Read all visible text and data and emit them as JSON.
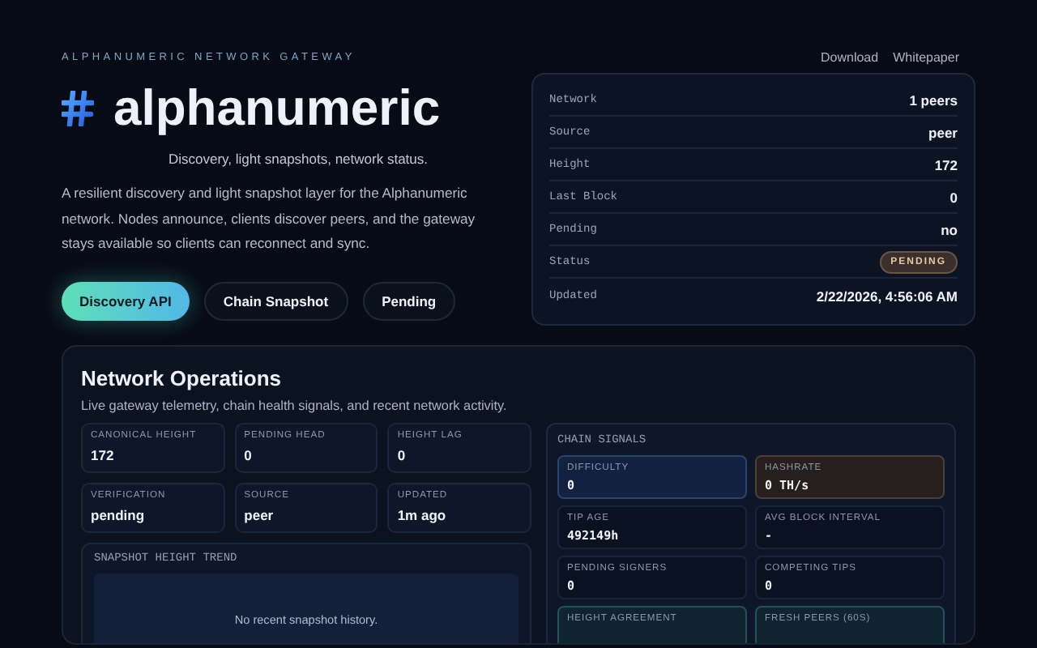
{
  "hero": {
    "eyebrow": "ALPHANUMERIC NETWORK GATEWAY",
    "title": "alphanumeric",
    "tagline": "Discovery, light snapshots, network status.",
    "description": "A resilient discovery and light snapshot layer for the Alphanumeric network. Nodes announce, clients discover peers, and the gateway stays available so clients can reconnect and sync.",
    "buttons": [
      {
        "label": "Discovery API",
        "kind": "primary"
      },
      {
        "label": "Chain Snapshot",
        "kind": "secondary"
      },
      {
        "label": "Pending",
        "kind": "secondary"
      }
    ]
  },
  "nav_links": [
    "Download",
    "Whitepaper"
  ],
  "status_card": {
    "rows": [
      {
        "label": "Network",
        "value": "1 peers",
        "kind": "text"
      },
      {
        "label": "Source",
        "value": "peer",
        "kind": "text"
      },
      {
        "label": "Height",
        "value": "172",
        "kind": "text"
      },
      {
        "label": "Last Block",
        "value": "0",
        "kind": "text"
      },
      {
        "label": "Pending",
        "value": "no",
        "kind": "text"
      },
      {
        "label": "Status",
        "value": "PENDING",
        "kind": "badge"
      },
      {
        "label": "Updated",
        "value": "2/22/2026, 4:56:06 AM",
        "kind": "text"
      }
    ]
  },
  "operations": {
    "title": "Network Operations",
    "subtitle": "Live gateway telemetry, chain health signals, and recent network activity.",
    "stats": [
      {
        "label": "CANONICAL HEIGHT",
        "value": "172"
      },
      {
        "label": "PENDING HEAD",
        "value": "0"
      },
      {
        "label": "HEIGHT LAG",
        "value": "0"
      },
      {
        "label": "VERIFICATION",
        "value": "pending"
      },
      {
        "label": "SOURCE",
        "value": "peer"
      },
      {
        "label": "UPDATED",
        "value": "1m ago"
      }
    ],
    "trend": {
      "title": "SNAPSHOT HEIGHT TREND",
      "empty_message": "No recent snapshot history."
    },
    "chain_signals": {
      "title": "CHAIN SIGNALS",
      "tiles": [
        {
          "label": "DIFFICULTY",
          "value": "0",
          "kind": "blue"
        },
        {
          "label": "HASHRATE",
          "value": "0 TH/s",
          "kind": "amber"
        },
        {
          "label": "TIP AGE",
          "value": "492149h",
          "kind": "plain"
        },
        {
          "label": "AVG BLOCK INTERVAL",
          "value": "-",
          "kind": "plain"
        },
        {
          "label": "PENDING SIGNERS",
          "value": "0",
          "kind": "plain"
        },
        {
          "label": "COMPETING TIPS",
          "value": "0",
          "kind": "plain"
        },
        {
          "label": "HEIGHT AGREEMENT",
          "kind": "teal"
        },
        {
          "label": "FRESH PEERS (60S)",
          "kind": "teal"
        }
      ]
    }
  }
}
